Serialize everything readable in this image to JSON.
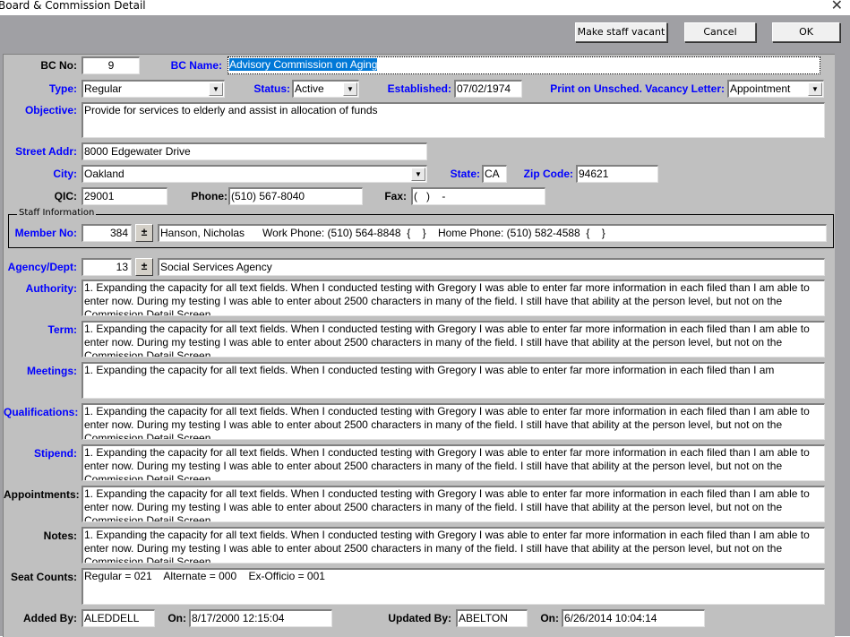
{
  "window": {
    "title": "Board & Commission Detail",
    "close_glyph": "✕"
  },
  "toolbar": {
    "make_vacant_label": "Make staff vacant",
    "cancel_label": "Cancel",
    "ok_label": "OK"
  },
  "form": {
    "bc_no": {
      "label": "BC No:",
      "value": "9"
    },
    "bc_name": {
      "label": "BC Name:",
      "value": "Advisory Commission on Aging"
    },
    "type": {
      "label": "Type:",
      "value": "Regular"
    },
    "status": {
      "label": "Status:",
      "value": "Active"
    },
    "established": {
      "label": "Established:",
      "value": "07/02/1974"
    },
    "print_vacancy": {
      "label": "Print on Unsched. Vacancy Letter:",
      "value": "Appointment"
    },
    "objective": {
      "label": "Objective:",
      "value": "Provide for services to elderly and assist in allocation of funds"
    },
    "street": {
      "label": "Street Addr:",
      "value": "8000 Edgewater Drive"
    },
    "city": {
      "label": "City:",
      "value": "Oakland"
    },
    "state": {
      "label": "State:",
      "value": "CA"
    },
    "zip": {
      "label": "Zip Code:",
      "value": "94621"
    },
    "qic": {
      "label": "QIC:",
      "value": "29001"
    },
    "phone": {
      "label": "Phone:",
      "value": "(510) 567-8040"
    },
    "fax": {
      "label": "Fax:",
      "value": "(   )    -"
    },
    "staff": {
      "group_title": "Staff Information",
      "member_no_label": "Member No:",
      "member_no": "384",
      "spin_glyph": "±",
      "member_info": "Hanson, Nicholas      Work Phone: (510) 564-8848  {    }    Home Phone: (510) 582-4588  {    }"
    },
    "agency": {
      "label": "Agency/Dept:",
      "code": "13",
      "name": "Social Services Agency"
    },
    "authority": {
      "label": "Authority:",
      "value": "1.  Expanding the capacity for all text fields.  When I conducted testing with Gregory I was able to enter far more information in each filed than I am able to enter now. During my testing I was able to enter about 2500 characters in many of the field.  I still have that ability at the person level, but not on the Commission Detail Screen"
    },
    "term": {
      "label": "Term:",
      "value": "1.  Expanding the capacity for all text fields.  When I conducted testing with Gregory I was able to enter far more information in each filed than I am able to enter now. During my testing I was able to enter about 2500 characters in many of the field.  I still have that ability at the person level, but not on the Commission Detail Screen"
    },
    "meetings": {
      "label": "Meetings:",
      "value": "1.  Expanding the capacity for all text fields.  When I conducted testing with Gregory I was able to enter far more information in each filed than I am"
    },
    "qualifications": {
      "label": "Qualifications:",
      "value": "1.  Expanding the capacity for all text fields.  When I conducted testing with Gregory I was able to enter far more information in each filed than I am able to enter now. During my testing I was able to enter about 2500 characters in many of the field.  I still have that ability at the person level, but not on the Commission Detail Screen"
    },
    "stipend": {
      "label": "Stipend:",
      "value": "1.  Expanding the capacity for all text fields.  When I conducted testing with Gregory I was able to enter far more information in each filed than I am able to enter now. During my testing I was able to enter about 2500 characters in many of the field.  I still have that ability at the person level, but not on the Commission Detail Screen"
    },
    "appointments": {
      "label": "Appointments:",
      "value": "1.  Expanding the capacity for all text fields.  When I conducted testing with Gregory I was able to enter far more information in each filed than I am able to enter now. During my testing I was able to enter about 2500 characters in many of the field.  I still have that ability at the person level, but not on the Commission Detail Screen"
    },
    "notes": {
      "label": "Notes:",
      "value": "1.  Expanding the capacity for all text fields.  When I conducted testing with Gregory I was able to enter far more information in each filed than I am able to enter now. During my testing I was able to enter about 2500 characters in many of the field.  I still have that ability at the person level, but not on the Commission Detail Screen"
    },
    "seat_counts": {
      "label": "Seat Counts:",
      "value": "Regular = 021    Alternate = 000    Ex-Officio = 001"
    },
    "added_by": {
      "label": "Added By:",
      "value": "ALEDDELL"
    },
    "added_on": {
      "label": "On:",
      "value": "8/17/2000 12:15:04"
    },
    "updated_by": {
      "label": "Updated By:",
      "value": "ABELTON"
    },
    "updated_on": {
      "label": "On:",
      "value": "6/26/2014 10:04:14"
    }
  },
  "icons": {
    "dropdown_arrow": "▼"
  }
}
